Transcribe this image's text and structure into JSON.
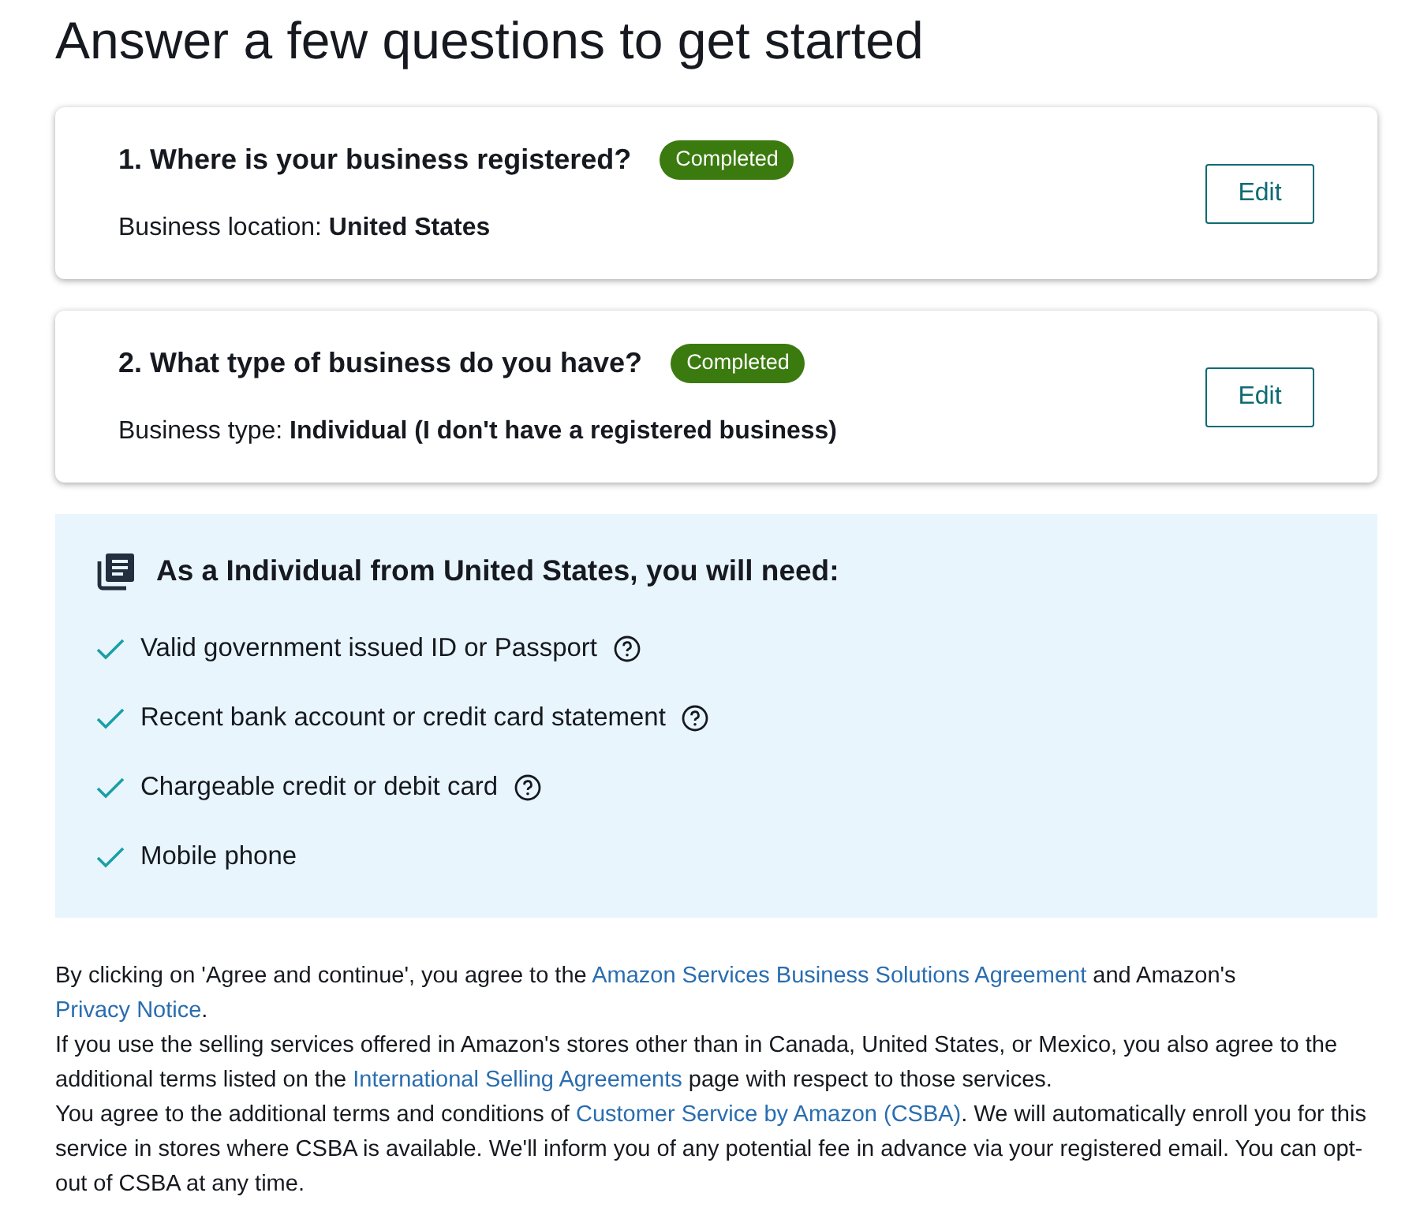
{
  "heading": "Answer a few questions to get started",
  "questions": [
    {
      "title": "1. Where is your business registered?",
      "status": "Completed",
      "completed": true,
      "answer": "Business location: **United States**",
      "button": "Edit"
    },
    {
      "title": "2. What type of business do you have?",
      "status": "Completed",
      "completed": true,
      "answer": "Business type: **Individual (I don't have a registered business)**",
      "button": "Edit"
    }
  ],
  "requirements": {
    "title": "As a Individual from United States, you will need:",
    "items": [
      {
        "label": "Valid government issued ID or Passport",
        "help": true
      },
      {
        "label": "Recent bank account or credit card statement",
        "help": true
      },
      {
        "label": "Chargeable credit or debit card",
        "help": true
      },
      {
        "label": "Mobile phone",
        "help": false
      }
    ]
  },
  "legal": [
    [
      {
        "kind": "text",
        "text": "By clicking on 'Agree and continue', you agree to the "
      },
      {
        "kind": "link",
        "text": "Amazon Services Business Solutions Agreement"
      },
      {
        "kind": "text",
        "text": " and Amazon's "
      },
      {
        "kind": "link",
        "text": "Privacy Notice"
      },
      {
        "kind": "text",
        "text": "."
      }
    ],
    [
      {
        "kind": "text",
        "text": "If you use the selling services offered in Amazon's stores other than in Canada, United States, or Mexico, you also agree to the additional terms listed on the "
      },
      {
        "kind": "link",
        "text": "International Selling Agreements"
      },
      {
        "kind": "text",
        "text": " page with respect to those services."
      }
    ],
    [
      {
        "kind": "text",
        "text": "You agree to the additional terms and conditions of "
      },
      {
        "kind": "link",
        "text": "Customer Service by Amazon (CSBA)"
      },
      {
        "kind": "text",
        "text": ". We will automatically enroll you for this service in stores where CSBA is available. We'll inform you of any potential fee in advance via your registered email. You can opt-out of CSBA at any time."
      }
    ]
  ]
}
